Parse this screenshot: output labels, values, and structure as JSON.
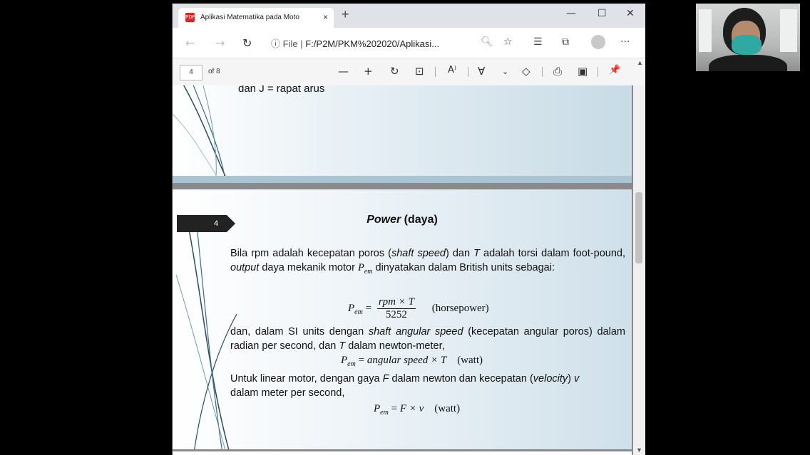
{
  "browser": {
    "tab_title": "Aplikasi Matematika pada Moto",
    "tab_close": "×",
    "new_tab": "+",
    "window_controls": {
      "minimize": "—",
      "maximize": "☐",
      "close": "✕"
    },
    "nav": {
      "back": "←",
      "forward": "→",
      "refresh": "↻"
    },
    "address": {
      "info_icon": "ⓘ",
      "scheme_label": "File",
      "separator": "|",
      "url": "F:/P2M/PKM%202020/Aplikasi..."
    },
    "toolbar_icons": [
      "zoom-icon",
      "favorite-star-icon",
      "favorites-list-icon",
      "collections-icon",
      "profile-avatar",
      "more-icon"
    ],
    "more": "···"
  },
  "pdf_toolbar": {
    "page_current": "4",
    "page_total": "of 8",
    "zoom_out": "—",
    "zoom_in": "+",
    "read_aloud": "A⁾",
    "pin": "📌"
  },
  "page_prev": {
    "carry_text": "dan J = rapat arus"
  },
  "page_current": {
    "page_number": "4",
    "title_italic": "Power",
    "title_rest": " (daya)",
    "para1_a": "Bila rpm adalah kecepatan poros (",
    "para1_b": "shaft speed",
    "para1_c": ") dan ",
    "para1_d": "T",
    "para1_e": " adalah torsi dalam foot-pound, ",
    "para1_f": "output",
    "para1_g": " daya mekanik motor ",
    "para1_h": " dinyatakan dalam British units sebagai:",
    "eq1_lhs": "P",
    "eq1_sub": "em",
    "eq1_num": "rpm × T",
    "eq1_den": "5252",
    "eq1_unit": "(horsepower)",
    "para2_a": "dan, dalam SI units dengan ",
    "para2_b": "shaft angular speed",
    "para2_c": "  (kecepatan angular poros) dalam radian per second, dan ",
    "para2_d": "T",
    "para2_e": " dalam newton-meter,",
    "eq2_rhs": "angular speed × T",
    "eq2_unit": "(watt)",
    "para3_a": "Untuk linear motor, dengan gaya ",
    "para3_b": "F",
    "para3_c": " dalam newton dan kecepatan (",
    "para3_d": "velocity",
    "para3_e": ") ",
    "para3_f": "v",
    "para3_g": " dalam meter per second,",
    "eq3_rhs": "F × v",
    "eq3_unit": "(watt)"
  }
}
